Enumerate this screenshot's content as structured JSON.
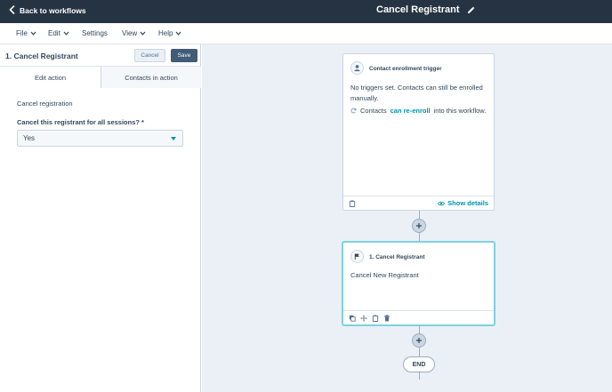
{
  "topbar": {
    "back_label": "Back to workflows",
    "title": "Cancel Registrant"
  },
  "menu": {
    "items": [
      {
        "label": "File",
        "has_chevron": true
      },
      {
        "label": "Edit",
        "has_chevron": true
      },
      {
        "label": "Settings",
        "has_chevron": false
      },
      {
        "label": "View",
        "has_chevron": true
      },
      {
        "label": "Help",
        "has_chevron": true
      }
    ]
  },
  "panel": {
    "title": "1. Cancel Registrant",
    "cancel_label": "Cancel",
    "save_label": "Save",
    "tabs": [
      {
        "label": "Edit action",
        "active": true
      },
      {
        "label": "Contacts in action",
        "active": false
      }
    ],
    "action_name": "Cancel registration",
    "field_label": "Cancel this registrant for all sessions? *",
    "field_value": "Yes"
  },
  "canvas": {
    "trigger_card": {
      "header": "Contact enrollment trigger",
      "body": "No triggers set. Contacts can still be enrolled manually.",
      "reenroll_prefix": "Contacts",
      "reenroll_link": "can re-enroll",
      "reenroll_suffix": "into this workflow.",
      "show_details": "Show details",
      "icon": "person-icon"
    },
    "action_card": {
      "header": "1. Cancel Registrant",
      "body": "Cancel New Registrant",
      "icon": "flag-icon"
    },
    "end_label": "END"
  },
  "colors": {
    "topbar_bg": "#253342",
    "canvas_bg": "#eaf0f6",
    "accent": "#0091ae",
    "save_bg": "#425b76",
    "selected_border": "#7fd1de"
  }
}
